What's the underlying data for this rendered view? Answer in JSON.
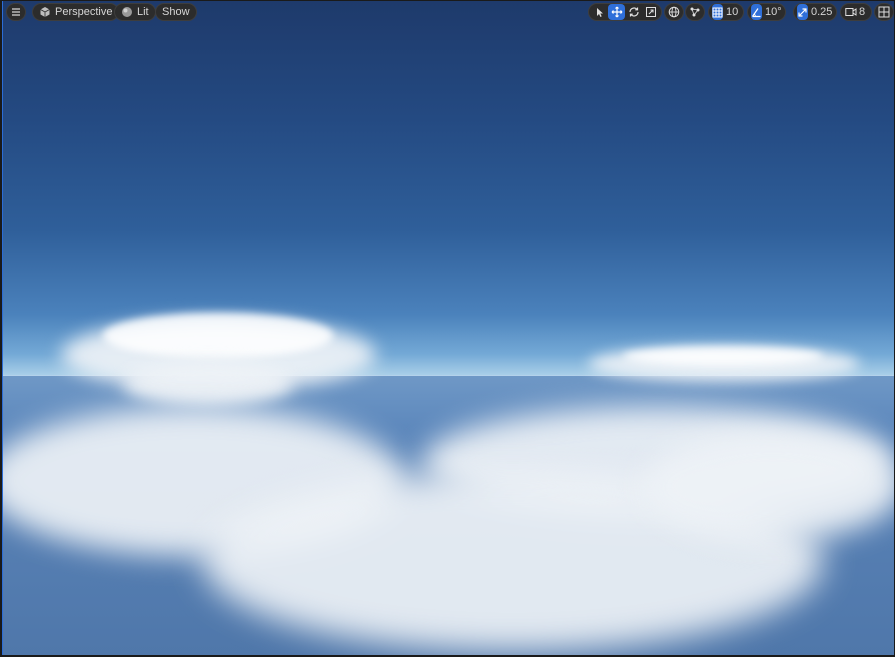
{
  "viewport": {
    "menu_icon": "hamburger-icon",
    "view_mode": {
      "icon": "cube-icon",
      "label": "Perspective"
    },
    "lighting": {
      "icon": "sphere-icon",
      "label": "Lit"
    },
    "show": {
      "label": "Show"
    },
    "transform_tools": [
      {
        "name": "select-icon",
        "active": false
      },
      {
        "name": "translate-icon",
        "active": true
      },
      {
        "name": "rotate-icon",
        "active": false
      },
      {
        "name": "scale-icon",
        "active": false
      }
    ],
    "coordinate_space_icon": "globe-icon",
    "surface_snap_icon": "surface-snap-icon",
    "grid_snap": {
      "icon": "grid-icon",
      "value": "10"
    },
    "rotation_snap": {
      "icon": "angle-icon",
      "value": "10°"
    },
    "scale_snap": {
      "icon": "scale-arrow-icon",
      "value": "0.25"
    },
    "camera_speed": {
      "icon": "camera-icon",
      "value": "8"
    },
    "layout_icon": "layout-icon"
  },
  "colors": {
    "accent": "#2f6fd9",
    "toolbar_bg": "#2c2c2c",
    "sky_top": "#1e3a6b",
    "ground": "#5e89bd"
  }
}
